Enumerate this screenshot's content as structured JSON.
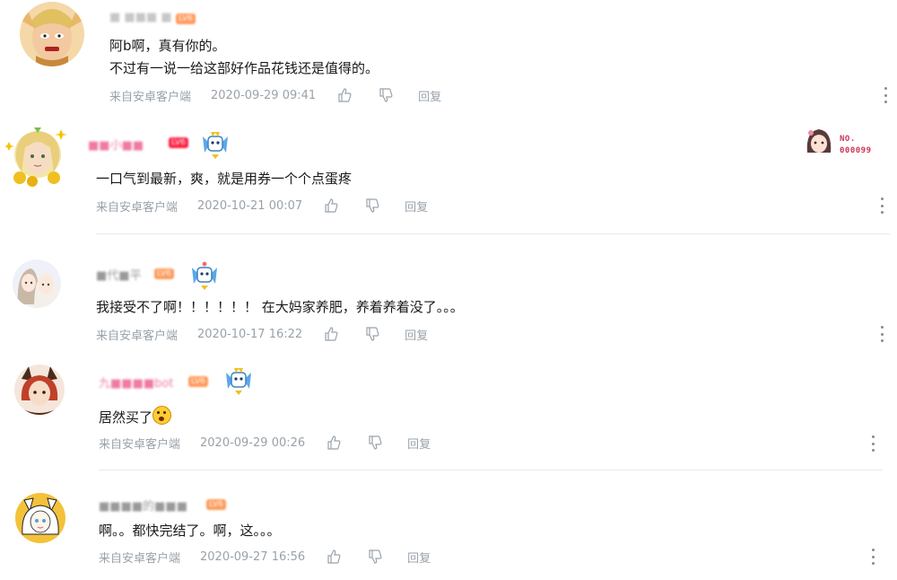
{
  "comments": [
    {
      "username": "■ ■■■ ■",
      "level": "LV6",
      "text_lines": [
        "阿b啊，真有你的。",
        "不过有一说一给这部好作品花钱还是值得的。"
      ],
      "source": "来自安卓客户端",
      "time": "2020-09-29 09:41",
      "reply_label": "回复",
      "avatar": "elf-villain-avatar-icon"
    },
    {
      "username": "■■小■■",
      "level": "LV6",
      "text_lines": [
        "一口气到最新，爽，就是用券一个个点蛋疼"
      ],
      "source": "来自安卓客户端",
      "time": "2020-10-21 00:07",
      "reply_label": "回复",
      "avatar": "blonde-girl-avatar-icon",
      "fan_badge": [
        "NO.",
        "000099"
      ]
    },
    {
      "username": "■代■平",
      "level": "LV6",
      "text_lines": [
        "我接受不了啊！！！！！！ 在大妈家养肥，养着养着没了。。。"
      ],
      "source": "来自安卓客户端",
      "time": "2020-10-17 16:22",
      "reply_label": "回复",
      "avatar": "two-girls-avatar-icon"
    },
    {
      "username": "九■■■■bot",
      "level": "LV6",
      "text_lines": [
        "居然买了"
      ],
      "source": "来自安卓客户端",
      "time": "2020-09-29 00:26",
      "reply_label": "回复",
      "avatar": "horned-character-avatar-icon"
    },
    {
      "username": "■■■■的■■■",
      "level": "LV6",
      "text_lines": [
        "啊。。都快完结了。啊，这。。。"
      ],
      "source": "来自安卓客户端",
      "time": "2020-09-27 16:56",
      "reply_label": "回复",
      "avatar": "white-hair-girl-avatar-icon"
    }
  ],
  "colors": {
    "text": "#18191c",
    "meta": "#99a2aa",
    "divider": "#e5e9ef",
    "level_badge": "#ff9a5a"
  }
}
